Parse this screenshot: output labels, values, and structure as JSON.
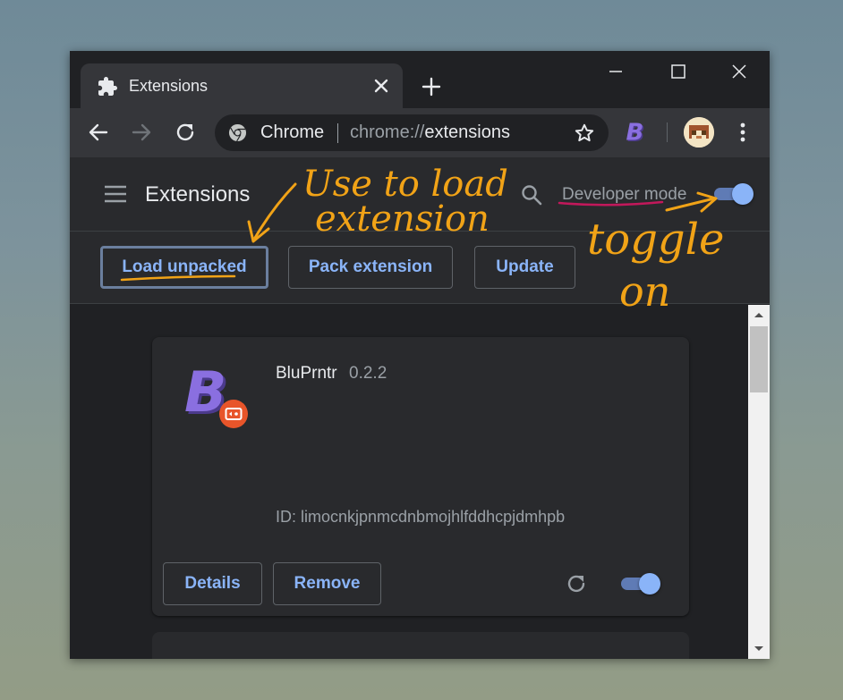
{
  "tab": {
    "title": "Extensions",
    "icon": "puzzle-piece-icon"
  },
  "window_controls": [
    "minimize-icon",
    "maximize-icon",
    "close-icon"
  ],
  "omnibox": {
    "site_label": "Chrome",
    "url_scheme": "chrome://",
    "url_host": "extensions"
  },
  "header": {
    "title": "Extensions",
    "developer_mode_label": "Developer mode",
    "developer_mode_on": true
  },
  "dev_buttons": {
    "load_unpacked": "Load unpacked",
    "pack_extension": "Pack extension",
    "update": "Update"
  },
  "extension_card": {
    "name": "BluPrntr",
    "version": "0.2.2",
    "id_text": "ID: limocnkjpnmcdnbmojhlfddhcpjdmhpb",
    "details_label": "Details",
    "remove_label": "Remove",
    "enabled": true
  },
  "annotations": {
    "load_note_line1": "Use to load",
    "load_note_line2": "extension",
    "toggle_note_line1": "toggle",
    "toggle_note_line2": "on"
  },
  "colors": {
    "accent_blue": "#8ab4f8",
    "annotation_orange": "#f1a317",
    "underline_magenta": "#c2185b",
    "brand_purple": "#7b5fc7",
    "badge_red": "#e8552a"
  }
}
